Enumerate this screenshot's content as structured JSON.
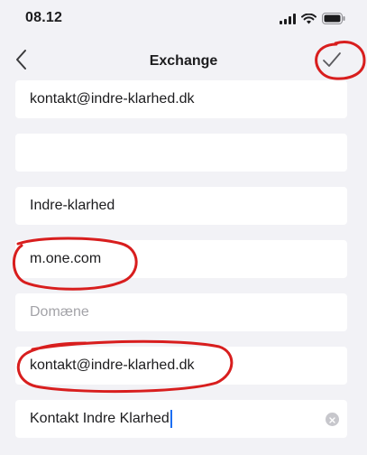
{
  "status_bar": {
    "time": "08.12"
  },
  "nav": {
    "title": "Exchange"
  },
  "fields": [
    {
      "value": "kontakt@indre-klarhed.dk",
      "placeholder": ""
    },
    {
      "value": "",
      "placeholder": ""
    },
    {
      "value": "Indre-klarhed",
      "placeholder": ""
    },
    {
      "value": "m.one.com",
      "placeholder": ""
    },
    {
      "value": "",
      "placeholder": "Domæne"
    },
    {
      "value": "kontakt@indre-klarhed.dk",
      "placeholder": ""
    },
    {
      "value": "Kontakt Indre Klarhed",
      "placeholder": ""
    }
  ],
  "colors": {
    "background": "#f2f2f6",
    "field_background": "#ffffff",
    "annotation_red": "#d81e1e",
    "caret_blue": "#1c6ef2",
    "placeholder_gray": "#a3a3a8"
  },
  "icons": {
    "back": "chevron-left-icon",
    "done": "checkmark-icon",
    "clear": "clear-x-icon",
    "signal": "cellular-signal-icon",
    "wifi": "wifi-icon",
    "battery": "battery-icon"
  }
}
